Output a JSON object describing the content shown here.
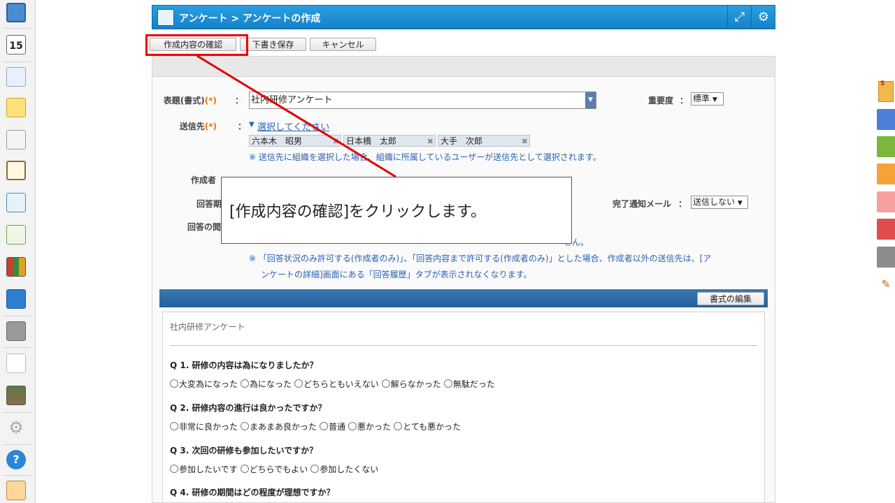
{
  "header": {
    "title": "アンケート > アンケートの作成",
    "expand_icon": "expand-icon",
    "settings_icon": "gear-icon"
  },
  "toolbar": {
    "confirm_label": "作成内容の確認",
    "draft_label": "下書き保存",
    "cancel_label": "キャンセル"
  },
  "left_rail": {
    "calendar_day": "15",
    "icons": [
      "portal-icon",
      "calendar-icon",
      "survey-analysis-icon",
      "memo-icon",
      "bulletin-icon",
      "report-icon",
      "survey-icon",
      "workflow-icon",
      "cabinet-icon",
      "neo-icon",
      "folder-icon",
      "tanomail-icon",
      "photo-icon",
      "settings-icon",
      "help-icon",
      "support-icon"
    ]
  },
  "form": {
    "title_label": "表題(書式)",
    "required_mark": "(*)",
    "colon": "：",
    "title_value": "社内研修アンケート",
    "importance_label": "重要度",
    "importance_value": "標準",
    "recipients_label": "送信先",
    "select_link": "選択してください",
    "recipients": [
      "六本木　昭男",
      "日本橋　太郎",
      "大手　次郎"
    ],
    "recipients_note": "※ 送信先に組織を選択した場合、組織に所属しているユーザーが送信先として選択されます。",
    "author_label": "作成者",
    "deadline_label": "回答期",
    "notify_label": "完了通知メール",
    "notify_value": "送信しない",
    "view_label": "回答の閲",
    "view_note_1": "※ 「回答状況のみ許可する(作成者のみ)」、「回答内容まで許可する(作成者のみ)」とした場合、作成者以外の送信先は、[ア",
    "view_note_2": "ンケートの詳細]画面にある「回答履歴」タブが表示されなくなります。",
    "hidden_note_tail": "せん。"
  },
  "survey": {
    "edit_button": "書式の編集",
    "name": "社内研修アンケート",
    "questions": [
      {
        "title": "Q 1. 研修の内容は為になりましたか？",
        "options": [
          "大変為になった",
          "為になった",
          "どちらともいえない",
          "解らなかった",
          "無駄だった"
        ]
      },
      {
        "title": "Q 2. 研修内容の進行は良かったですか？",
        "options": [
          "非常に良かった",
          "まあまあ良かった",
          "普通",
          "悪かった",
          "とても悪かった"
        ]
      },
      {
        "title": "Q 3. 次回の研修も参加したいですか？",
        "options": [
          "参加したいです",
          "どちらでもよい",
          "参加したくない"
        ]
      },
      {
        "title": "Q 4. 研修の期間はどの程度が理想ですか？",
        "options": []
      }
    ]
  },
  "callout": {
    "text": "[作成内容の確認]をクリックします。",
    "highlight_color": "#e00000"
  },
  "colors": {
    "header_blue": "#1a8ad2",
    "survey_bar": "#2d6aa8",
    "required_orange": "#e8730e",
    "note_blue": "#2a62b5"
  }
}
